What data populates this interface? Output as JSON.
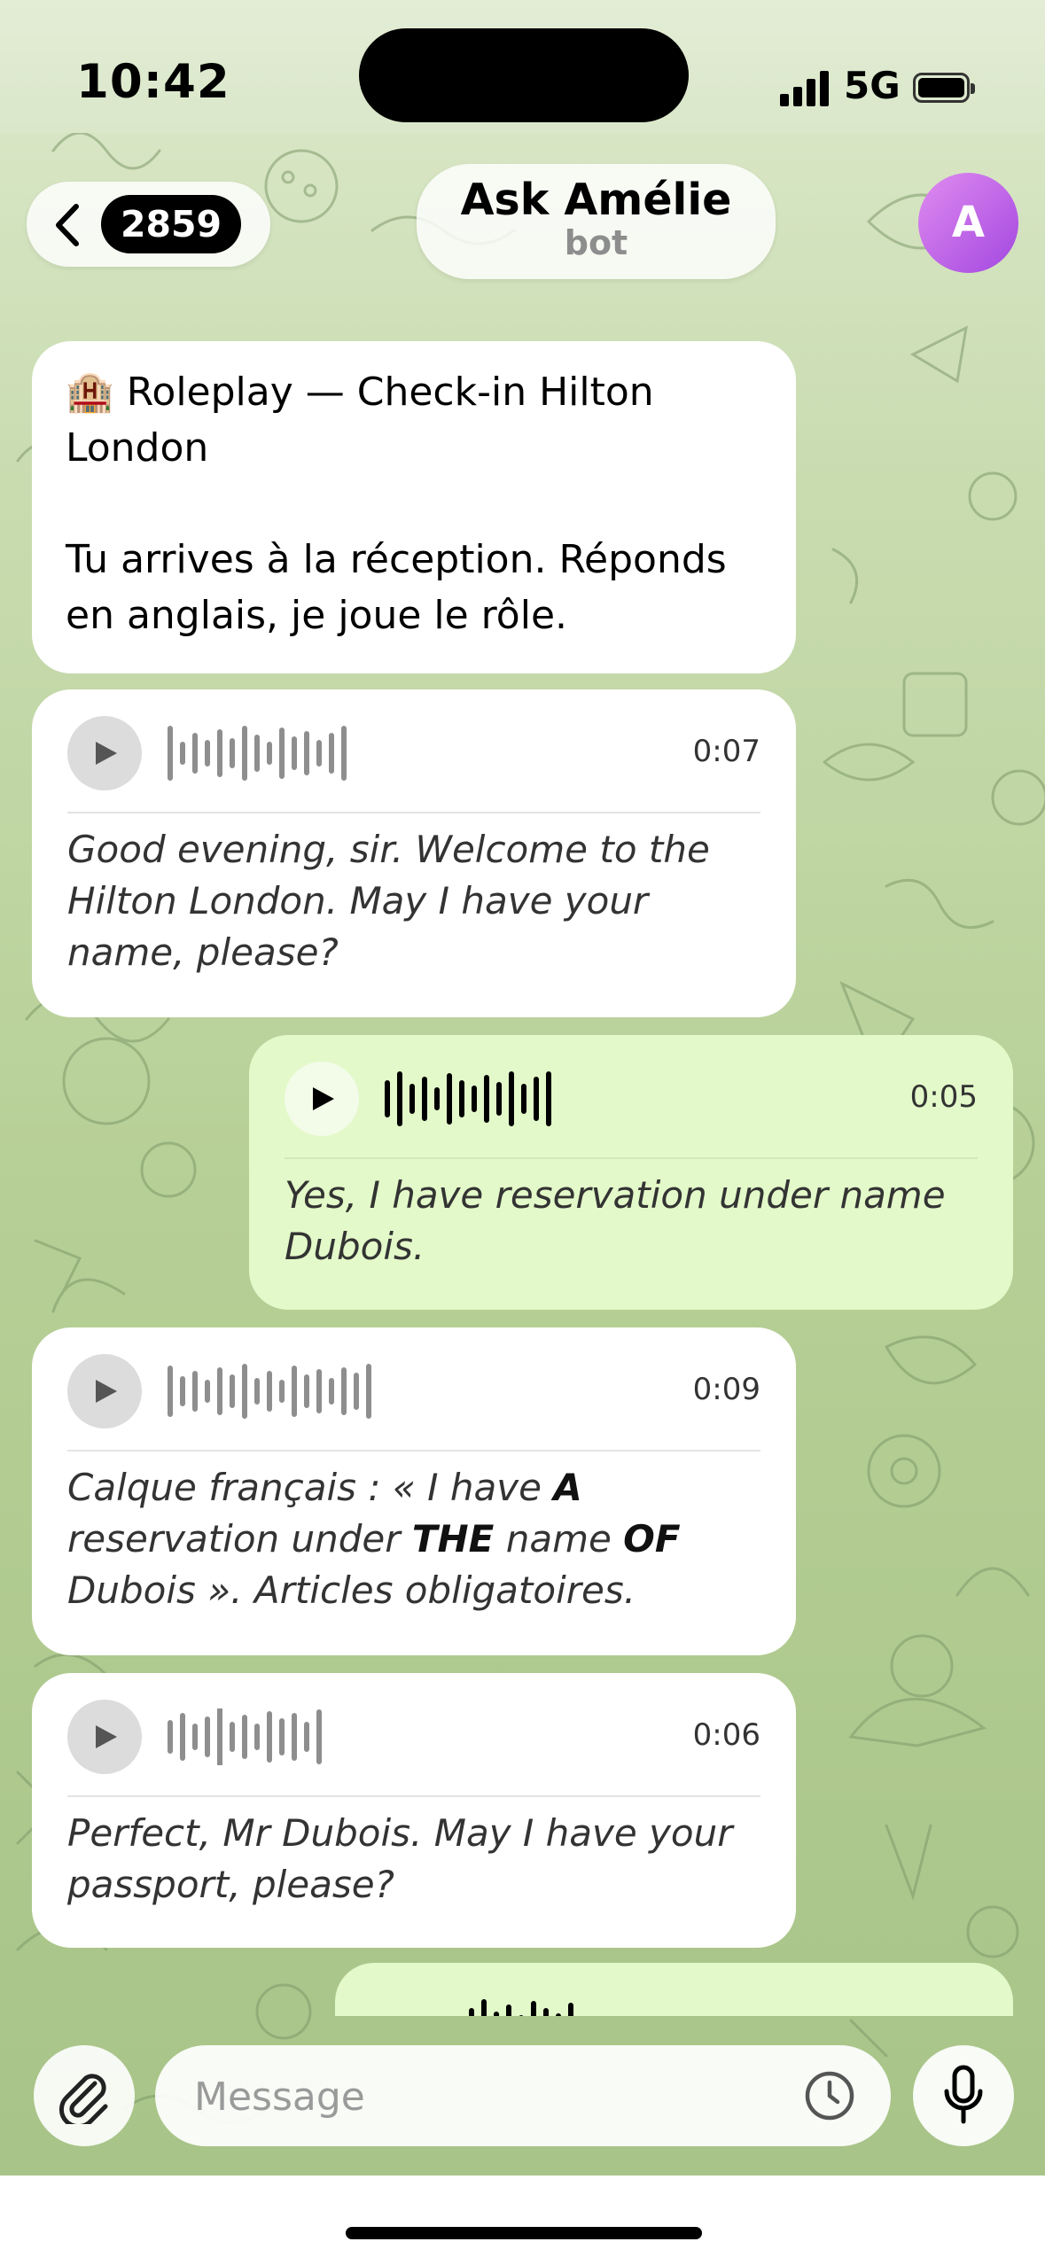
{
  "status": {
    "time": "10:42",
    "network": "5G"
  },
  "header": {
    "unread_count": "2859",
    "title": "Ask Amélie",
    "subtitle": "bot",
    "avatar_letter": "A"
  },
  "messages": [
    {
      "type": "text",
      "direction": "in",
      "emoji": "🏨",
      "lines": [
        "Roleplay — Check-in Hilton London",
        "",
        "Tu arrives à la réception. Réponds en anglais, je joue le rôle."
      ]
    },
    {
      "type": "voice",
      "direction": "in",
      "duration": "0:07",
      "transcript": "Good evening, sir. Welcome to the Hilton London. May I have your name, please?"
    },
    {
      "type": "voice",
      "direction": "out",
      "duration": "0:05",
      "transcript": "Yes, I have reservation under name Dubois."
    },
    {
      "type": "voice",
      "direction": "in",
      "duration": "0:09",
      "transcript_parts": [
        "Calque français : « I have ",
        "A",
        " reservation under ",
        "THE",
        " name ",
        "OF",
        " Dubois ». Articles obligatoires."
      ]
    },
    {
      "type": "voice",
      "direction": "in",
      "duration": "0:06",
      "transcript": "Perfect, Mr Dubois. May I have your passport, please?"
    }
  ],
  "composer": {
    "placeholder": "Message"
  },
  "colors": {
    "incoming_bubble": "#ffffff",
    "outgoing_bubble": "#e3f9c9",
    "avatar": "#b95ae8",
    "wallpaper": "#b6cf96"
  },
  "icons": {
    "back": "chevron-left-icon",
    "attach": "paperclip-icon",
    "schedule": "clock-icon",
    "voice": "microphone-icon",
    "play": "play-icon"
  }
}
